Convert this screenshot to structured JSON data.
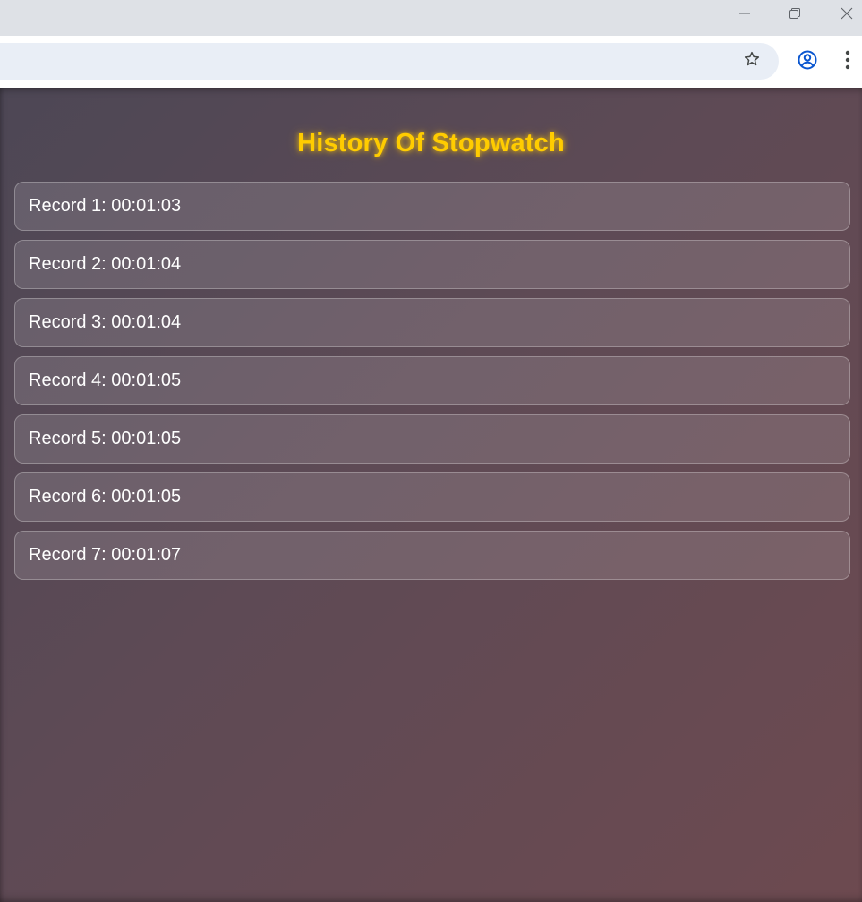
{
  "browser": {
    "window_controls": {
      "minimize_icon": "minimize-icon",
      "restore_icon": "restore-icon",
      "close_icon": "close-icon"
    },
    "toolbar": {
      "bookmark_icon": "star-icon",
      "profile_icon": "account-circle-icon",
      "menu_icon": "vertical-dots-icon"
    },
    "colors": {
      "profile_accent": "#0b57d0",
      "omnibox_bg": "#e9eef6"
    }
  },
  "page": {
    "title": "History Of Stopwatch",
    "colors": {
      "title": "#ffcc00",
      "record_text": "#ffffff"
    },
    "records": [
      {
        "label": "Record 1: 00:01:03"
      },
      {
        "label": "Record 2: 00:01:04"
      },
      {
        "label": "Record 3: 00:01:04"
      },
      {
        "label": "Record 4: 00:01:05"
      },
      {
        "label": "Record 5: 00:01:05"
      },
      {
        "label": "Record 6: 00:01:05"
      },
      {
        "label": "Record 7: 00:01:07"
      }
    ]
  }
}
